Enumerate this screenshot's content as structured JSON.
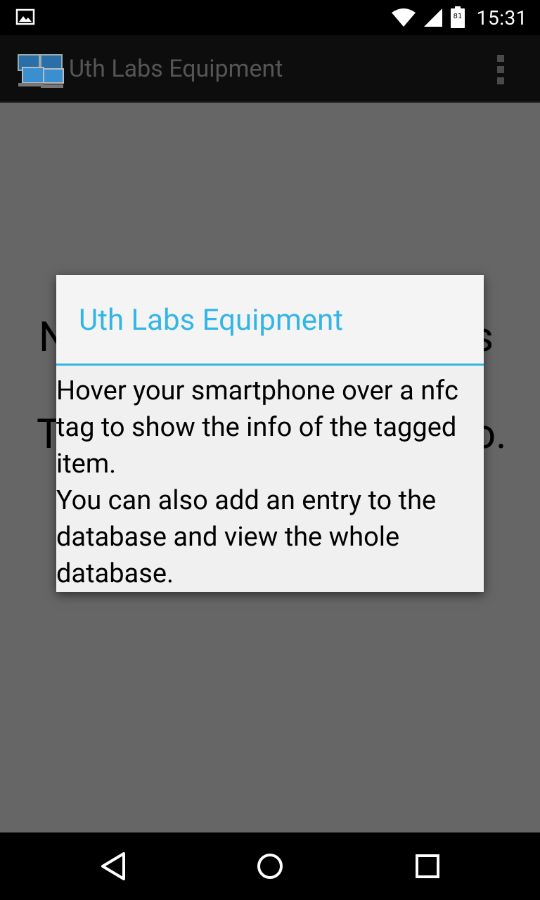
{
  "status_bar": {
    "time": "15:31",
    "battery_level": "81",
    "icons": [
      "image-notification-icon",
      "wifi-icon",
      "signal-icon",
      "battery-icon"
    ]
  },
  "action_bar": {
    "title": "Uth Labs Equipment",
    "app_icon": "computers-app-icon",
    "overflow_icon": "overflow-menu-icon"
  },
  "background_text": {
    "line1_start": "N",
    "line1_end": "s",
    "line2_start": "T",
    "line2_end": "o."
  },
  "dialog": {
    "title": "Uth Labs Equipment",
    "message_line1": "Hover your smartphone over a nfc tag to show the info of the tagged item.",
    "message_line2": "You can also add an entry to the database and view the whole database."
  },
  "nav_bar": {
    "icons": [
      "back-icon",
      "home-icon",
      "recents-icon"
    ]
  },
  "colors": {
    "accent": "#33b5e5",
    "dim_overlay": "#666666",
    "dialog_bg": "#f0f0f0"
  }
}
